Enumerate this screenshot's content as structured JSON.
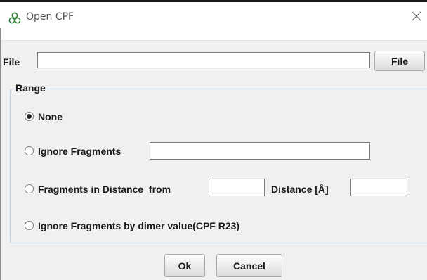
{
  "window": {
    "title": "Open CPF"
  },
  "file": {
    "label": "File",
    "value": "",
    "button_label": "File"
  },
  "range": {
    "legend": "Range",
    "options": [
      {
        "label": "None",
        "selected": true
      },
      {
        "label": "Ignore Fragments",
        "selected": false
      },
      {
        "label": "Fragments in Distance  from",
        "selected": false
      },
      {
        "label": "Ignore Fragments by dimer value(CPF R23)",
        "selected": false
      }
    ],
    "ignore_fragments_value": "",
    "from_value": "",
    "distance_label": "Distance [Å]",
    "distance_value": ""
  },
  "buttons": {
    "ok": "Ok",
    "cancel": "Cancel"
  },
  "icons": {
    "app": "molecule-icon",
    "close": "close-icon"
  }
}
